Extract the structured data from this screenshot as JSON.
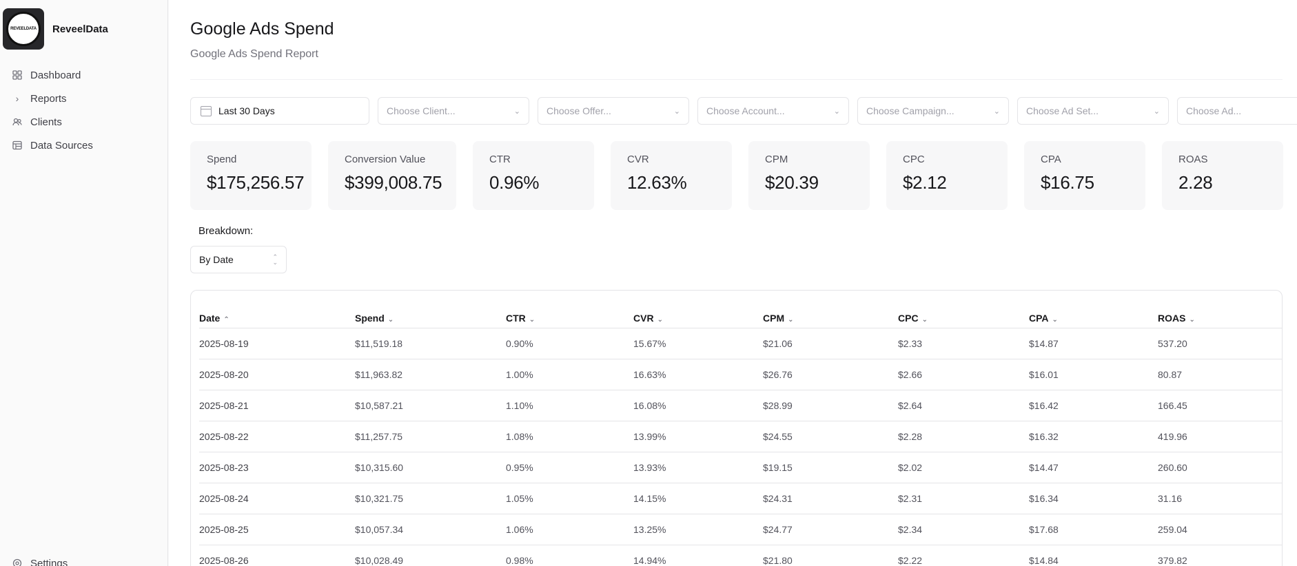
{
  "brand": {
    "name": "ReveelData",
    "logo_text": "REVEELDATA"
  },
  "sidebar": {
    "items": [
      {
        "label": "Dashboard",
        "icon": "grid-icon"
      },
      {
        "label": "Reports",
        "icon": "chevron-right-icon"
      },
      {
        "label": "Clients",
        "icon": "users-icon"
      },
      {
        "label": "Data Sources",
        "icon": "database-icon"
      }
    ],
    "settings": {
      "label": "Settings",
      "icon": "gear-icon"
    }
  },
  "page": {
    "title": "Google Ads Spend",
    "subtitle": "Google Ads Spend Report"
  },
  "filters": {
    "date_range": "Last 30 Days",
    "client": "Choose Client...",
    "offer": "Choose Offer...",
    "account": "Choose Account...",
    "campaign": "Choose Campaign...",
    "ad_set": "Choose Ad Set...",
    "ad": "Choose Ad..."
  },
  "stats": [
    {
      "label": "Spend",
      "value": "$175,256.57"
    },
    {
      "label": "Conversion Value",
      "value": "$399,008.75"
    },
    {
      "label": "CTR",
      "value": "0.96%"
    },
    {
      "label": "CVR",
      "value": "12.63%"
    },
    {
      "label": "CPM",
      "value": "$20.39"
    },
    {
      "label": "CPC",
      "value": "$2.12"
    },
    {
      "label": "CPA",
      "value": "$16.75"
    },
    {
      "label": "ROAS",
      "value": "2.28"
    }
  ],
  "breakdown": {
    "label": "Breakdown:",
    "value": "By Date"
  },
  "table": {
    "columns": [
      "Date",
      "Spend",
      "CTR",
      "CVR",
      "CPM",
      "CPC",
      "CPA",
      "ROAS"
    ],
    "sort": {
      "column": "Date",
      "direction": "asc"
    },
    "rows": [
      [
        "2025-08-19",
        "$11,519.18",
        "0.90%",
        "15.67%",
        "$21.06",
        "$2.33",
        "$14.87",
        "537.20"
      ],
      [
        "2025-08-20",
        "$11,963.82",
        "1.00%",
        "16.63%",
        "$26.76",
        "$2.66",
        "$16.01",
        "80.87"
      ],
      [
        "2025-08-21",
        "$10,587.21",
        "1.10%",
        "16.08%",
        "$28.99",
        "$2.64",
        "$16.42",
        "166.45"
      ],
      [
        "2025-08-22",
        "$11,257.75",
        "1.08%",
        "13.99%",
        "$24.55",
        "$2.28",
        "$16.32",
        "419.96"
      ],
      [
        "2025-08-23",
        "$10,315.60",
        "0.95%",
        "13.93%",
        "$19.15",
        "$2.02",
        "$14.47",
        "260.60"
      ],
      [
        "2025-08-24",
        "$10,321.75",
        "1.05%",
        "14.15%",
        "$24.31",
        "$2.31",
        "$16.34",
        "31.16"
      ],
      [
        "2025-08-25",
        "$10,057.34",
        "1.06%",
        "13.25%",
        "$24.77",
        "$2.34",
        "$17.68",
        "259.04"
      ],
      [
        "2025-08-26",
        "$10,028.49",
        "0.98%",
        "14.94%",
        "$21.80",
        "$2.22",
        "$14.84",
        "379.82"
      ]
    ]
  }
}
